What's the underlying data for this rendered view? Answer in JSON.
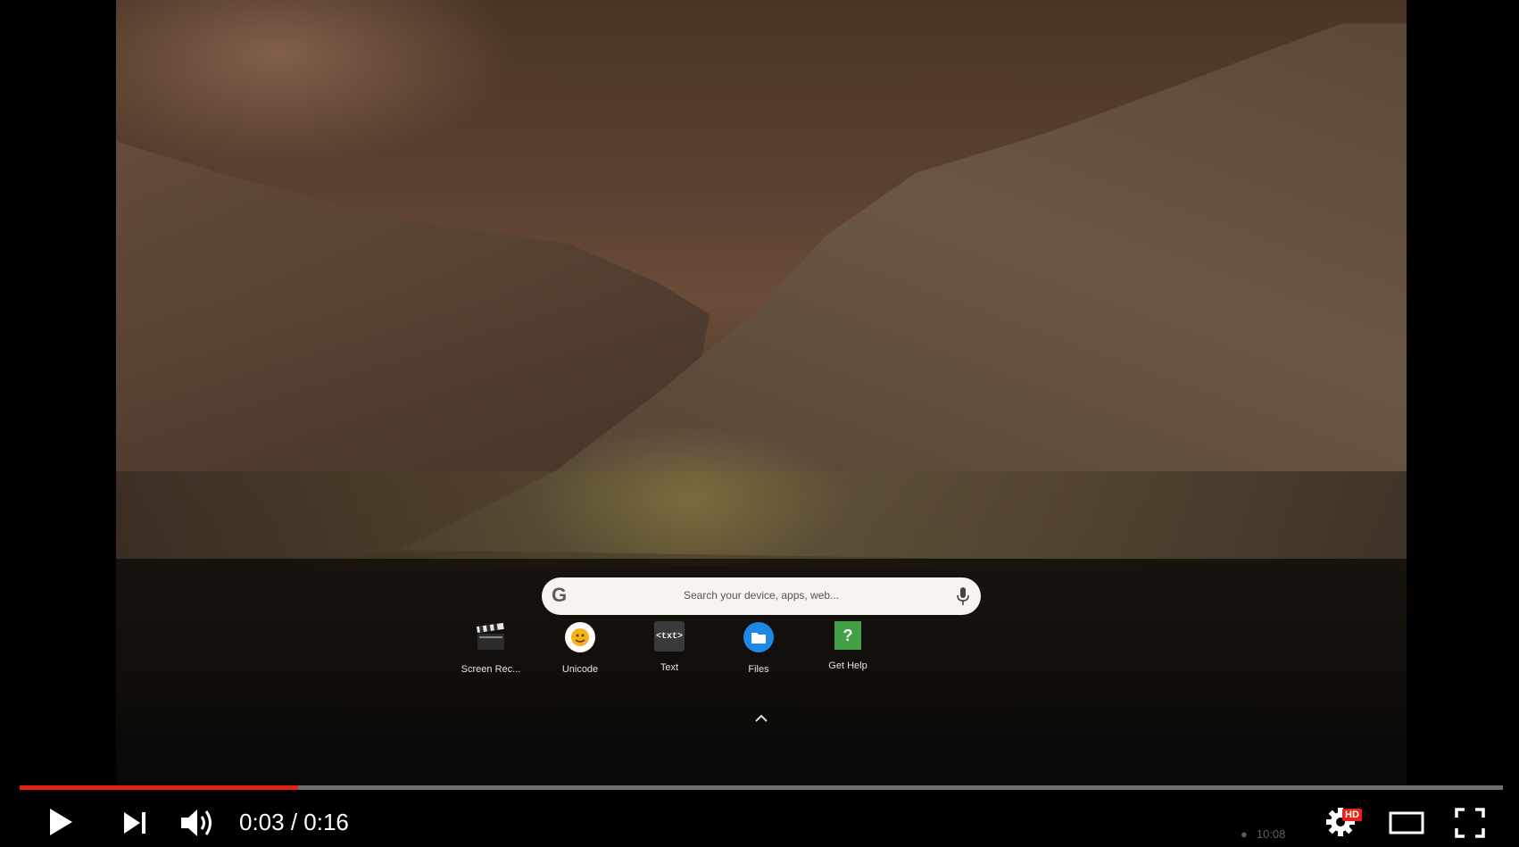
{
  "launcher": {
    "search_placeholder": "Search your device, apps, web...",
    "google_logo": "G",
    "apps": [
      {
        "label": "Screen Rec...",
        "icon": "clapperboard-icon"
      },
      {
        "label": "Unicode",
        "icon": "emoji-face-icon"
      },
      {
        "label": "Text",
        "icon": "text-editor-icon",
        "icon_text": "<txt>"
      },
      {
        "label": "Files",
        "icon": "folder-icon"
      },
      {
        "label": "Get Help",
        "icon": "question-mark-icon",
        "icon_text": "?"
      }
    ]
  },
  "player": {
    "current_time": "0:03",
    "duration": "0:16",
    "time_text": "0:03 / 0:16",
    "progress_fraction": 0.1875,
    "hd_badge": "HD",
    "accent_color": "#e62117"
  },
  "shelf": {
    "clock": "10:08"
  }
}
